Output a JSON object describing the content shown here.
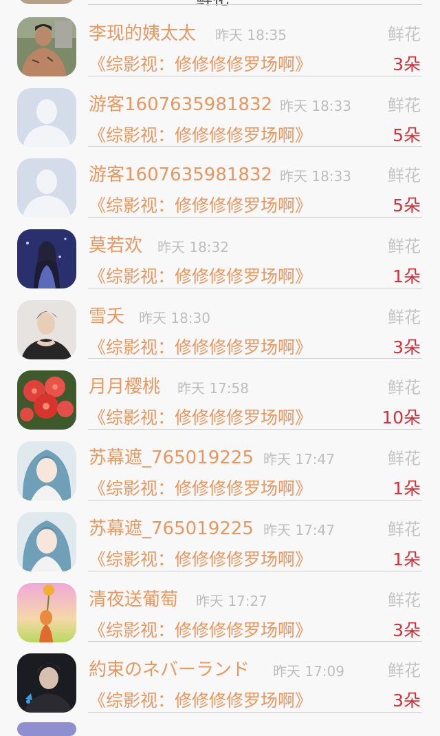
{
  "top_fragment": {
    "text": "鲜花"
  },
  "rows": [
    {
      "name": "李现的姨太太",
      "time": "昨天 18:35",
      "gift_type": "鲜花",
      "book": "《综影视：修修修修罗场啊》",
      "count": "3朵",
      "avatar": "man-photo"
    },
    {
      "name": "游客1607635981832",
      "time": "昨天 18:33",
      "gift_type": "鲜花",
      "book": "《综影视：修修修修罗场啊》",
      "count": "5朵",
      "avatar": "default-user"
    },
    {
      "name": "游客1607635981832",
      "time": "昨天 18:33",
      "gift_type": "鲜花",
      "book": "《综影视：修修修修罗场啊》",
      "count": "5朵",
      "avatar": "default-user"
    },
    {
      "name": "莫若欢",
      "time": "昨天 18:32",
      "gift_type": "鲜花",
      "book": "《综影视：修修修修罗场啊》",
      "count": "1朵",
      "avatar": "anime-girl"
    },
    {
      "name": "雪夭",
      "time": "昨天 18:30",
      "gift_type": "鲜花",
      "book": "《综影视：修修修修罗场啊》",
      "count": "3朵",
      "avatar": "man-portrait"
    },
    {
      "name": "月月樱桃",
      "time": "昨天 17:58",
      "gift_type": "鲜花",
      "book": "《综影视：修修修修罗场啊》",
      "count": "10朵",
      "avatar": "red-flowers"
    },
    {
      "name": "苏幕遮_765019225",
      "time": "昨天 17:47",
      "gift_type": "鲜花",
      "book": "《综影视：修修修修罗场啊》",
      "count": "1朵",
      "avatar": "anime-blue-hair"
    },
    {
      "name": "苏幕遮_765019225",
      "time": "昨天 17:47",
      "gift_type": "鲜花",
      "book": "《综影视：修修修修罗场啊》",
      "count": "1朵",
      "avatar": "anime-blue-hair"
    },
    {
      "name": "清夜送葡萄",
      "time": "昨天 17:27",
      "gift_type": "鲜花",
      "book": "《综影视：修修修修罗场啊》",
      "count": "3朵",
      "avatar": "sunflower-girl"
    },
    {
      "name": "約束のネバーランド",
      "time": "昨天 17:09",
      "gift_type": "鲜花",
      "book": "《综影视：修修修修罗场啊》",
      "count": "3朵",
      "avatar": "anime-dark-boy"
    }
  ],
  "colors": {
    "name": "#e8975f",
    "count": "#d2313a",
    "muted": "#bdbdbd"
  }
}
